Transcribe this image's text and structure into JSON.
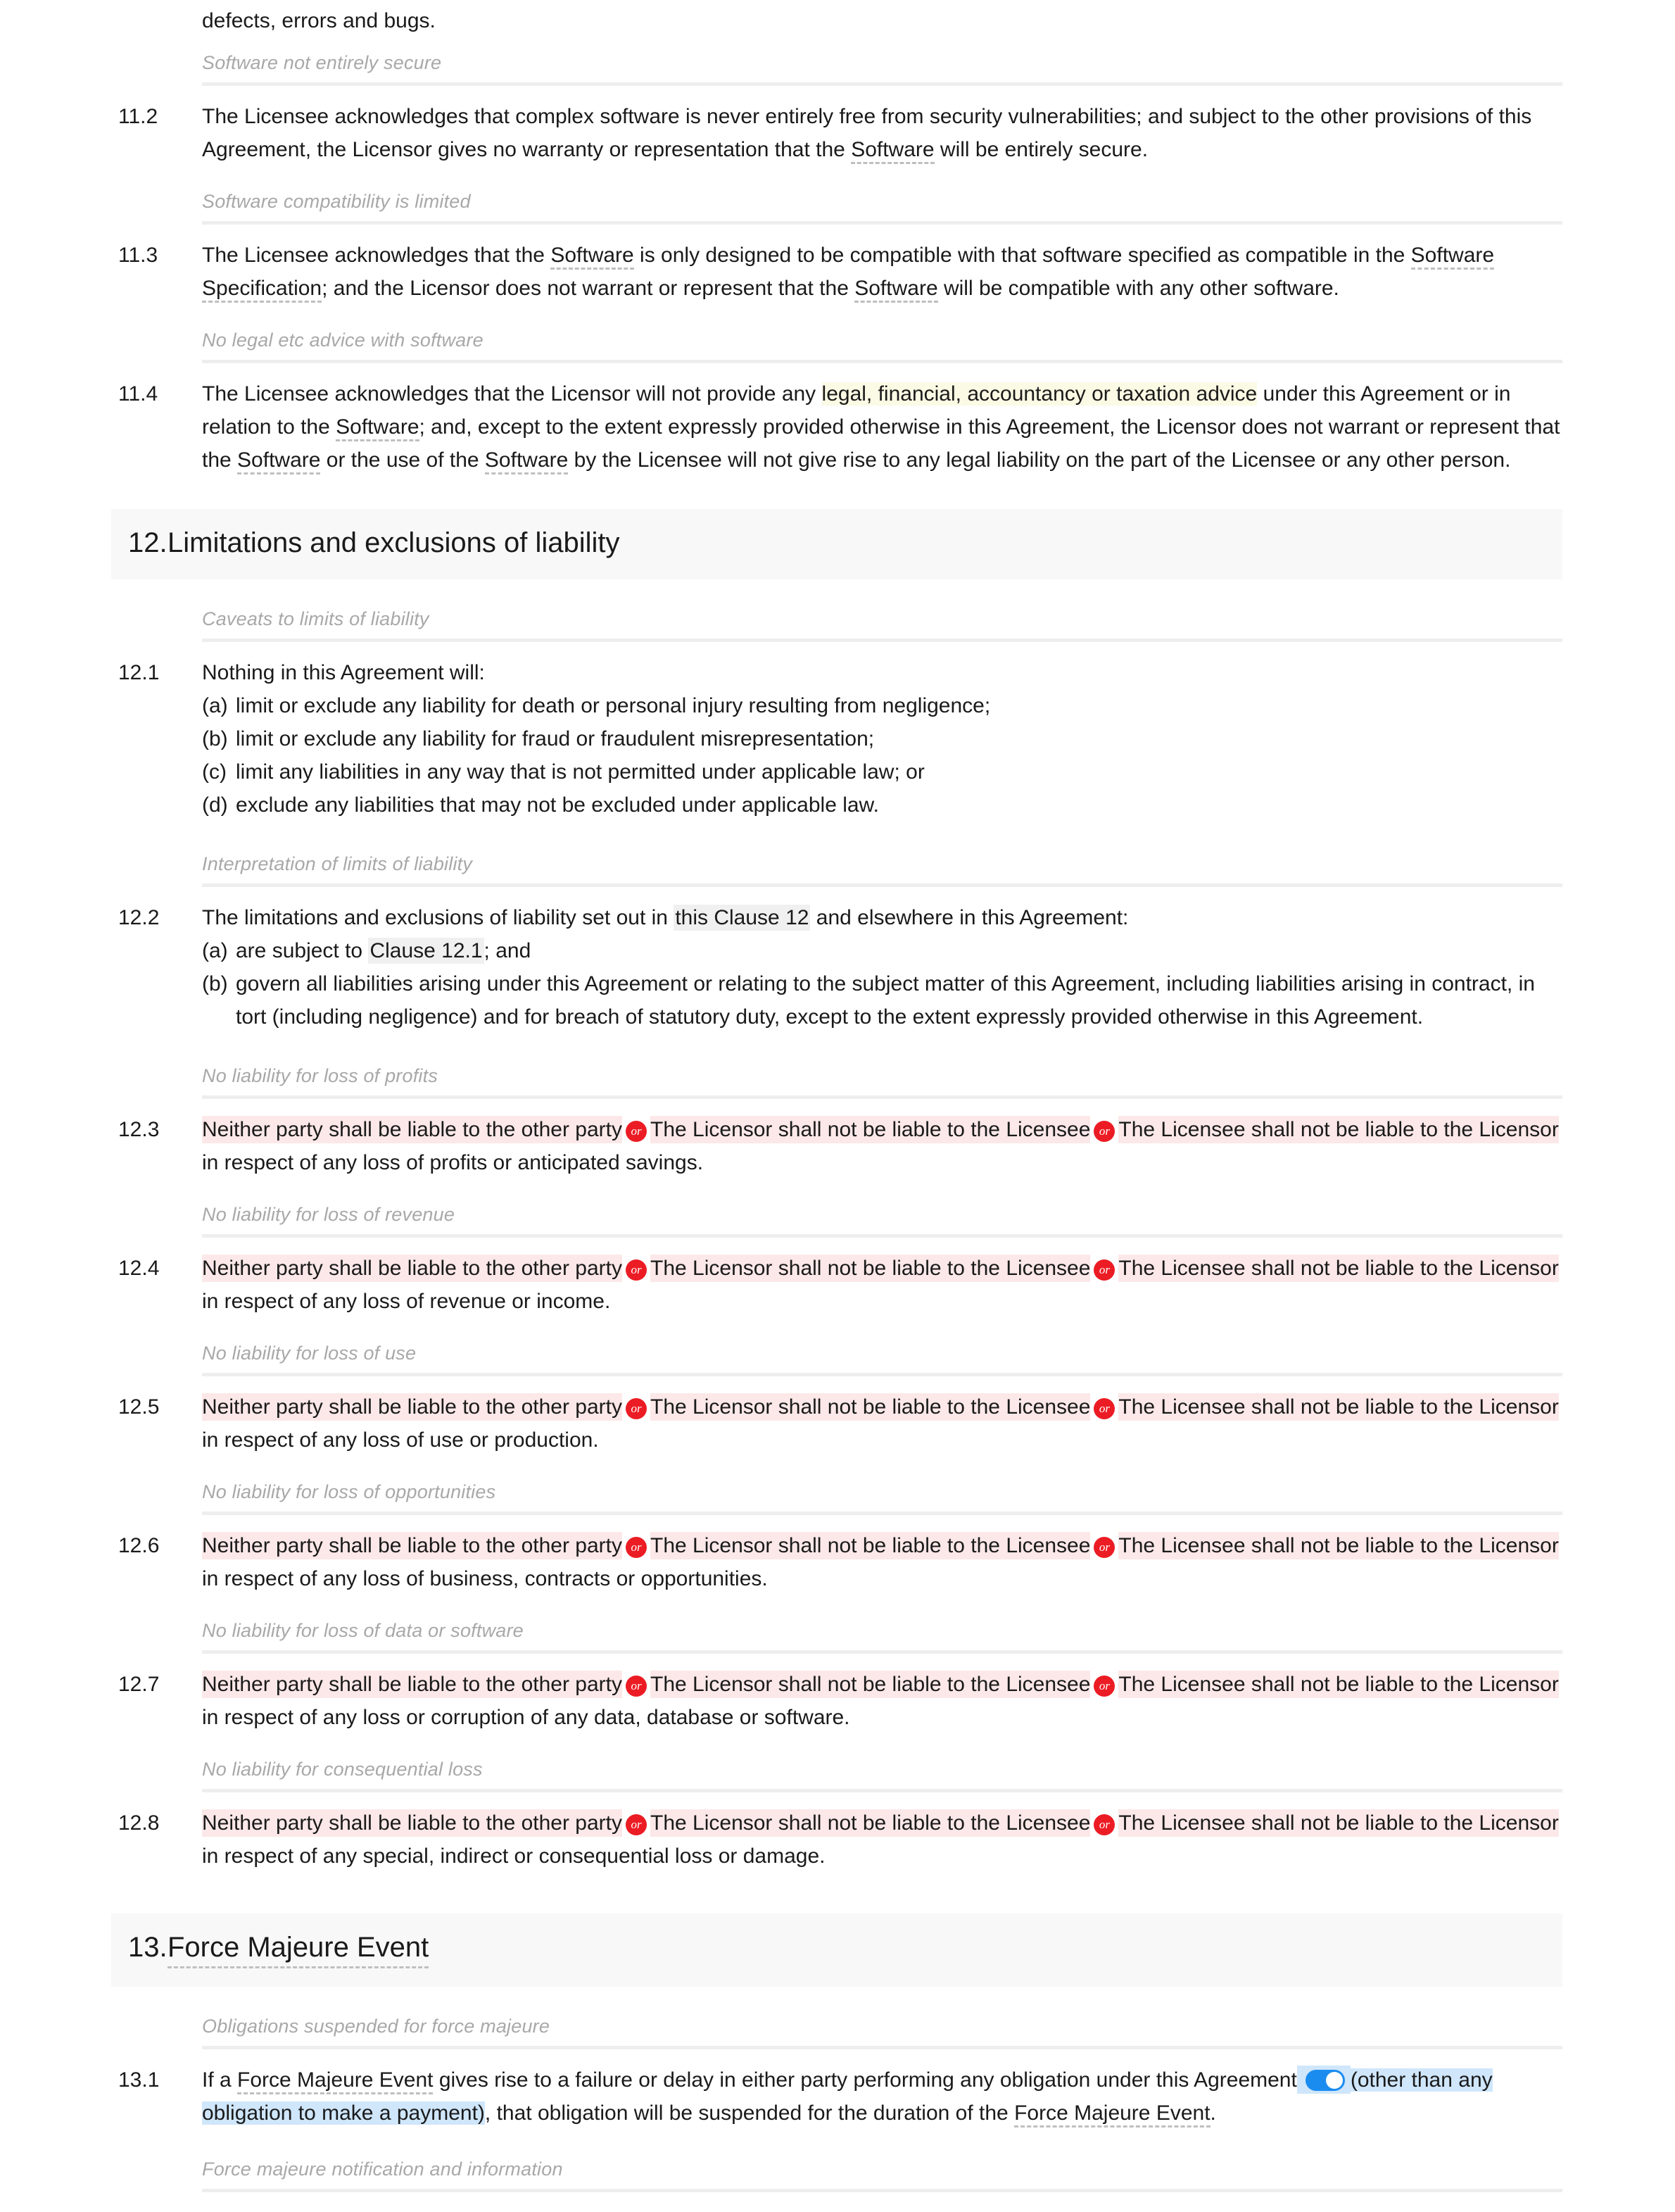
{
  "colors": {
    "accent_or_badge": "#ec1c24",
    "alt_highlight": "#fce8e8",
    "yellow_highlight": "#fbfae4",
    "blue_highlight": "#cfe6fb",
    "toggle_on": "#1a8cf0",
    "section_band": "#f8f8f8",
    "xref_highlight": "#f0f0f0",
    "caption_text": "#a8a8a8",
    "divider": "#eeeeee"
  },
  "top_continuation": {
    "text": "defects, errors and bugs."
  },
  "clauses": [
    {
      "caption": "Software not entirely secure",
      "number": "11.2",
      "text_a": "The Licensee acknowledges that complex software is never entirely free from security vulnerabilities; and subject to the other provisions of this Agreement, the Licensor gives no warranty or representation that the ",
      "defterm": "Software",
      "text_b": " will be entirely secure."
    },
    {
      "caption": "Software compatibility is limited",
      "number": "11.3",
      "text_a": "The Licensee acknowledges that the ",
      "defterm_1": "Software",
      "text_b": " is only designed to be compatible with that software specified as compatible in the ",
      "defterm_2": "Software Specification",
      "text_c": "; and the Licensor does not warrant or represent that the ",
      "defterm_3": "Software",
      "text_d": " will be compatible with any other software."
    },
    {
      "caption": "No legal etc advice with software",
      "number": "11.4",
      "text_a": "The Licensee acknowledges that the Licensor will not provide any ",
      "highlight": "legal, financial, accountancy or taxation advice",
      "text_b": " under this Agreement or in relation to the ",
      "defterm_1": "Software",
      "text_c": "; and, except to the extent expressly provided otherwise in this Agreement, the Licensor does not warrant or represent that the ",
      "defterm_2": "Software",
      "text_d": " or the use of the ",
      "defterm_3": "Software",
      "text_e": " by the Licensee will not give rise to any legal liability on the part of the Licensee or any other person."
    }
  ],
  "section_12": {
    "number": "12.",
    "title": "Limitations and exclusions of liability",
    "clause_12_1": {
      "caption": "Caveats to limits of liability",
      "number": "12.1",
      "lead": "Nothing in this Agreement will:",
      "items": [
        {
          "letter": "(a)",
          "text": "limit or exclude any liability for death or personal injury resulting from negligence;"
        },
        {
          "letter": "(b)",
          "text": "limit or exclude any liability for fraud or fraudulent misrepresentation;"
        },
        {
          "letter": "(c)",
          "text": "limit any liabilities in any way that is not permitted under applicable law; or"
        },
        {
          "letter": "(d)",
          "text": "exclude any liabilities that may not be excluded under applicable law."
        }
      ]
    },
    "clause_12_2": {
      "caption": "Interpretation of limits of liability",
      "number": "12.2",
      "lead_a": "The limitations and exclusions of liability set out in ",
      "xref_1": "this Clause 12",
      "lead_b": " and elsewhere in this Agreement:",
      "item_a_letter": "(a)",
      "item_a_text_a": "are subject to ",
      "item_a_xref": "Clause 12.1",
      "item_a_text_b": "; and",
      "item_b_letter": "(b)",
      "item_b_text": "govern all liabilities arising under this Agreement or relating to the subject matter of this Agreement, including liabilities arising in contract, in tort (including negligence) and for breach of statutory duty, except to the extent expressly provided otherwise in this Agreement."
    },
    "alternative_clauses": [
      {
        "caption": "No liability for loss of profits",
        "number": "12.3",
        "alt_1": "Neither party shall be liable to the other party",
        "or_1": "or",
        "alt_2": "The Licensor shall not be liable to the Licensee",
        "or_2": "or",
        "alt_3": "The Licensee shall not be liable to the Licensor",
        "tail": " in respect of any loss of profits or anticipated savings."
      },
      {
        "caption": "No liability for loss of revenue",
        "number": "12.4",
        "alt_1": "Neither party shall be liable to the other party",
        "or_1": "or",
        "alt_2": "The Licensor shall not be liable to the Licensee",
        "or_2": "or",
        "alt_3": "The Licensee shall not be liable to the Licensor",
        "tail": " in respect of any loss of revenue or income."
      },
      {
        "caption": "No liability for loss of use",
        "number": "12.5",
        "alt_1": "Neither party shall be liable to the other party",
        "or_1": "or",
        "alt_2": "The Licensor shall not be liable to the Licensee",
        "or_2": "or",
        "alt_3": "The Licensee shall not be liable to the Licensor",
        "tail": " in respect of any loss of use or production."
      },
      {
        "caption": "No liability for loss of opportunities",
        "number": "12.6",
        "alt_1": "Neither party shall be liable to the other party",
        "or_1": "or",
        "alt_2": "The Licensor shall not be liable to the Licensee",
        "or_2": "or",
        "alt_3": "The Licensee shall not be liable to the Licensor",
        "tail": " in respect of any loss of business, contracts or opportunities."
      },
      {
        "caption": "No liability for loss of data or software",
        "number": "12.7",
        "alt_1": "Neither party shall be liable to the other party",
        "or_1": "or",
        "alt_2": "The Licensor shall not be liable to the Licensee",
        "or_2": "or",
        "alt_3": "The Licensee shall not be liable to the Licensor",
        "tail": " in respect of any loss or corruption of any data, database or software."
      },
      {
        "caption": "No liability for consequential loss",
        "number": "12.8",
        "alt_1": "Neither party shall be liable to the other party",
        "or_1": "or",
        "alt_2": "The Licensor shall not be liable to the Licensee",
        "or_2": "or",
        "alt_3": "The Licensee shall not be liable to the Licensor",
        "tail": " in respect of any special, indirect or consequential loss or damage."
      }
    ]
  },
  "section_13": {
    "number": "13.",
    "title": "Force Majeure Event",
    "clause_13_1": {
      "caption": "Obligations suspended for force majeure",
      "number": "13.1",
      "text_a": "If a ",
      "defterm_1": "Force Majeure Event",
      "text_b": " gives rise to a failure or delay in either party performing any obligation under this Agreement",
      "optional_text": "(other than any obligation to make a payment)",
      "text_c": ", that obligation will be suspended for the duration of the ",
      "defterm_2": "Force Majeure Event",
      "text_d": "."
    },
    "trailing_caption": "Force majeure notification and information"
  }
}
